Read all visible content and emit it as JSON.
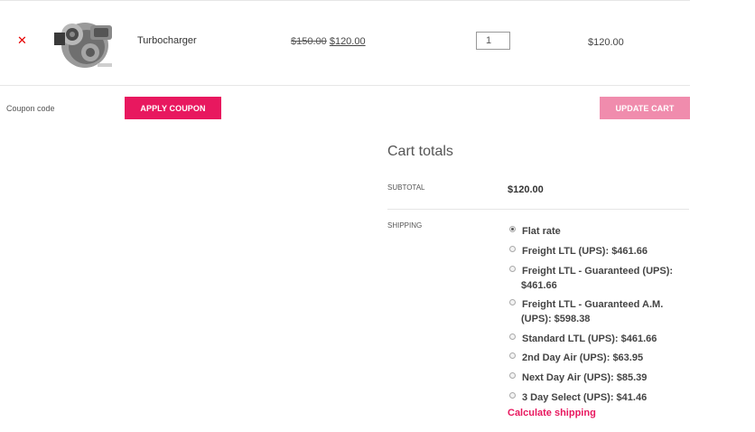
{
  "cart_item": {
    "name": "Turbocharger",
    "old_price": "$150.00",
    "price": "$120.00",
    "quantity": "1",
    "line_total": "$120.00"
  },
  "coupon": {
    "placeholder": "Coupon code",
    "apply_label": "APPLY COUPON"
  },
  "update_label": "UPDATE CART",
  "cart_totals": {
    "title": "Cart totals",
    "subtotal_label": "SUBTOTAL",
    "subtotal_value": "$120.00",
    "shipping_label": "SHIPPING",
    "options": [
      {
        "line1": "Flat rate",
        "line2": "",
        "selected": true
      },
      {
        "line1": "Freight LTL (UPS): $461.66",
        "line2": "",
        "selected": false
      },
      {
        "line1": "Freight LTL - Guaranteed (UPS):",
        "line2": "$461.66",
        "selected": false
      },
      {
        "line1": "Freight LTL - Guaranteed A.M.",
        "line2": "(UPS): $598.38",
        "selected": false
      },
      {
        "line1": "Standard LTL (UPS): $461.66",
        "line2": "",
        "selected": false
      },
      {
        "line1": "2nd Day Air (UPS): $63.95",
        "line2": "",
        "selected": false
      },
      {
        "line1": "Next Day Air (UPS): $85.39",
        "line2": "",
        "selected": false
      },
      {
        "line1": "3 Day Select (UPS): $41.46",
        "line2": "",
        "selected": false
      }
    ],
    "calculate_shipping": "Calculate shipping"
  },
  "icons": {
    "remove": "close-icon",
    "product_image": "turbocharger-image"
  },
  "colors": {
    "accent": "#e8185f",
    "accent_light": "#f08cad",
    "remove": "#e60000"
  }
}
